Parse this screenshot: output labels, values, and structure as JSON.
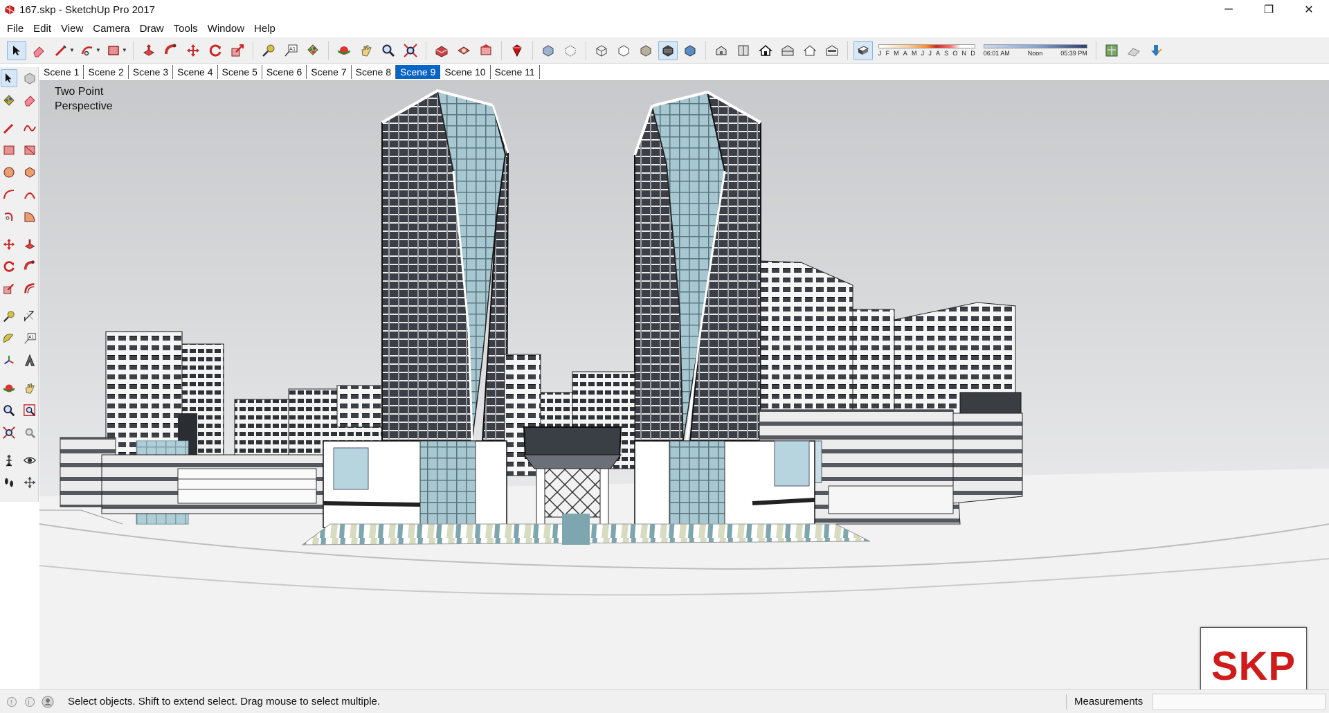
{
  "window": {
    "title": "167.skp - SketchUp Pro 2017",
    "minimize": "─",
    "restore": "❐",
    "close": "✕"
  },
  "menu": [
    "File",
    "Edit",
    "View",
    "Camera",
    "Draw",
    "Tools",
    "Window",
    "Help"
  ],
  "shadow_settings": {
    "months": [
      "J",
      "F",
      "M",
      "A",
      "M",
      "J",
      "J",
      "A",
      "S",
      "O",
      "N",
      "D"
    ],
    "time_start": "06:01 AM",
    "time_noon": "Noon",
    "time_end": "05:39 PM"
  },
  "scenes": {
    "tabs": [
      "Scene 1",
      "Scene 2",
      "Scene 3",
      "Scene 4",
      "Scene 5",
      "Scene 6",
      "Scene 7",
      "Scene 8",
      "Scene 9",
      "Scene 10",
      "Scene 11"
    ],
    "active": "Scene 9"
  },
  "viewport": {
    "camera_label": "Two Point\nPerspective",
    "watermark": "SKP"
  },
  "status": {
    "hint": "Select objects. Shift to extend select. Drag mouse to select multiple.",
    "measurements_label": "Measurements",
    "measurements_value": ""
  },
  "colors": {
    "accent": "#0a64c8",
    "toolbar_bg": "#f0f0f0",
    "glass": "#a9cdd8",
    "tower_dark": "#3a3d42",
    "logo_red": "#d11a1a"
  }
}
